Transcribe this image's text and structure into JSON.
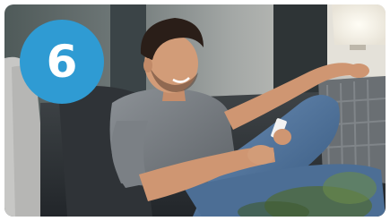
{
  "badge": {
    "number": "6",
    "color": "#2f9bd3"
  },
  "photo": {
    "subject": "smiling-man-on-couch-with-phone"
  }
}
